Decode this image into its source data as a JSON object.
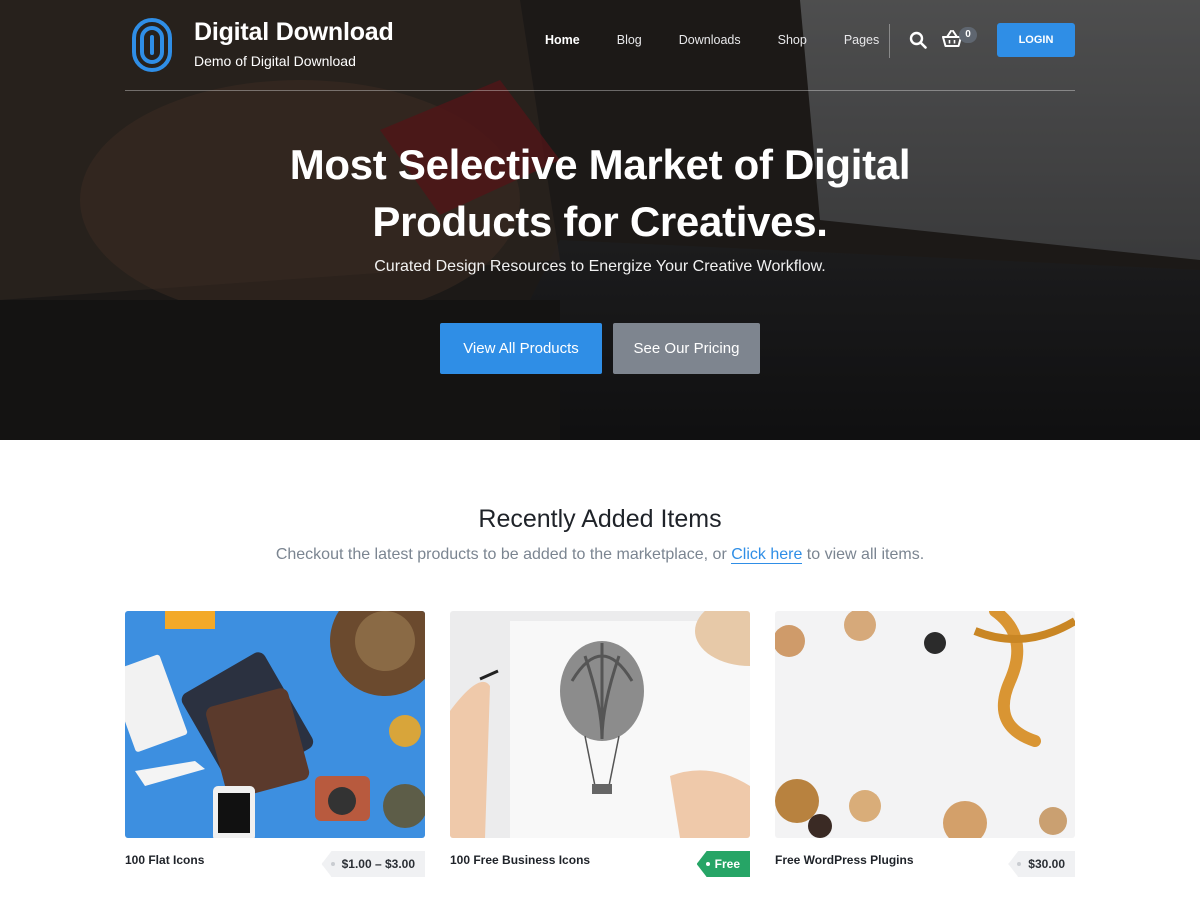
{
  "header": {
    "site_title": "Digital Download",
    "tagline": "Demo of Digital Download",
    "nav": [
      "Home",
      "Blog",
      "Downloads",
      "Shop",
      "Pages"
    ],
    "cart_count": "0",
    "login_label": "LOGIN",
    "icons": [
      "fingerprint-logo-icon",
      "search-icon",
      "basket-icon"
    ]
  },
  "hero": {
    "title_line1": "Most Selective Market of Digital",
    "title_line2": "Products for Creatives.",
    "subtitle": "Curated Design Resources to Energize Your Creative Workflow.",
    "primary_button": "View All Products",
    "secondary_button": "See Our Pricing"
  },
  "recent": {
    "title": "Recently Added Items",
    "subtitle_before": "Checkout the latest products to be added to the marketplace, or ",
    "subtitle_link": "Click here",
    "subtitle_after": " to view all items.",
    "items": [
      {
        "name": "100 Flat Icons",
        "price": "$1.00 – $3.00"
      },
      {
        "name": "100 Free Business Icons",
        "price": "Free"
      },
      {
        "name": "Free WordPress Plugins",
        "price": "$30.00"
      }
    ]
  },
  "colors": {
    "accent": "#2f8ee6",
    "secondary_button": "#7e858f",
    "free_tag": "#26a566",
    "heading": "#1f2329"
  }
}
